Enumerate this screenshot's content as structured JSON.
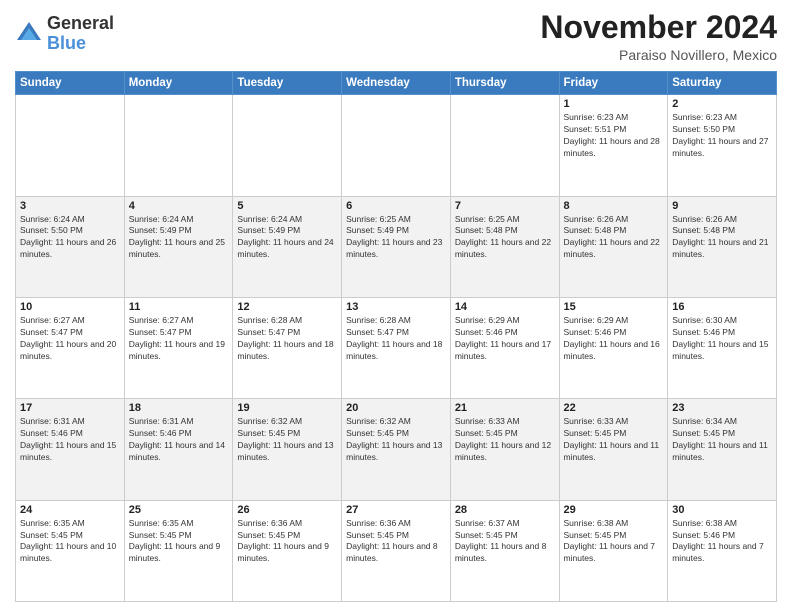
{
  "logo": {
    "general": "General",
    "blue": "Blue"
  },
  "title": "November 2024",
  "location": "Paraiso Novillero, Mexico",
  "days_of_week": [
    "Sunday",
    "Monday",
    "Tuesday",
    "Wednesday",
    "Thursday",
    "Friday",
    "Saturday"
  ],
  "weeks": [
    [
      {
        "day": "",
        "info": ""
      },
      {
        "day": "",
        "info": ""
      },
      {
        "day": "",
        "info": ""
      },
      {
        "day": "",
        "info": ""
      },
      {
        "day": "",
        "info": ""
      },
      {
        "day": "1",
        "info": "Sunrise: 6:23 AM\nSunset: 5:51 PM\nDaylight: 11 hours and 28 minutes."
      },
      {
        "day": "2",
        "info": "Sunrise: 6:23 AM\nSunset: 5:50 PM\nDaylight: 11 hours and 27 minutes."
      }
    ],
    [
      {
        "day": "3",
        "info": "Sunrise: 6:24 AM\nSunset: 5:50 PM\nDaylight: 11 hours and 26 minutes."
      },
      {
        "day": "4",
        "info": "Sunrise: 6:24 AM\nSunset: 5:49 PM\nDaylight: 11 hours and 25 minutes."
      },
      {
        "day": "5",
        "info": "Sunrise: 6:24 AM\nSunset: 5:49 PM\nDaylight: 11 hours and 24 minutes."
      },
      {
        "day": "6",
        "info": "Sunrise: 6:25 AM\nSunset: 5:49 PM\nDaylight: 11 hours and 23 minutes."
      },
      {
        "day": "7",
        "info": "Sunrise: 6:25 AM\nSunset: 5:48 PM\nDaylight: 11 hours and 22 minutes."
      },
      {
        "day": "8",
        "info": "Sunrise: 6:26 AM\nSunset: 5:48 PM\nDaylight: 11 hours and 22 minutes."
      },
      {
        "day": "9",
        "info": "Sunrise: 6:26 AM\nSunset: 5:48 PM\nDaylight: 11 hours and 21 minutes."
      }
    ],
    [
      {
        "day": "10",
        "info": "Sunrise: 6:27 AM\nSunset: 5:47 PM\nDaylight: 11 hours and 20 minutes."
      },
      {
        "day": "11",
        "info": "Sunrise: 6:27 AM\nSunset: 5:47 PM\nDaylight: 11 hours and 19 minutes."
      },
      {
        "day": "12",
        "info": "Sunrise: 6:28 AM\nSunset: 5:47 PM\nDaylight: 11 hours and 18 minutes."
      },
      {
        "day": "13",
        "info": "Sunrise: 6:28 AM\nSunset: 5:47 PM\nDaylight: 11 hours and 18 minutes."
      },
      {
        "day": "14",
        "info": "Sunrise: 6:29 AM\nSunset: 5:46 PM\nDaylight: 11 hours and 17 minutes."
      },
      {
        "day": "15",
        "info": "Sunrise: 6:29 AM\nSunset: 5:46 PM\nDaylight: 11 hours and 16 minutes."
      },
      {
        "day": "16",
        "info": "Sunrise: 6:30 AM\nSunset: 5:46 PM\nDaylight: 11 hours and 15 minutes."
      }
    ],
    [
      {
        "day": "17",
        "info": "Sunrise: 6:31 AM\nSunset: 5:46 PM\nDaylight: 11 hours and 15 minutes."
      },
      {
        "day": "18",
        "info": "Sunrise: 6:31 AM\nSunset: 5:46 PM\nDaylight: 11 hours and 14 minutes."
      },
      {
        "day": "19",
        "info": "Sunrise: 6:32 AM\nSunset: 5:45 PM\nDaylight: 11 hours and 13 minutes."
      },
      {
        "day": "20",
        "info": "Sunrise: 6:32 AM\nSunset: 5:45 PM\nDaylight: 11 hours and 13 minutes."
      },
      {
        "day": "21",
        "info": "Sunrise: 6:33 AM\nSunset: 5:45 PM\nDaylight: 11 hours and 12 minutes."
      },
      {
        "day": "22",
        "info": "Sunrise: 6:33 AM\nSunset: 5:45 PM\nDaylight: 11 hours and 11 minutes."
      },
      {
        "day": "23",
        "info": "Sunrise: 6:34 AM\nSunset: 5:45 PM\nDaylight: 11 hours and 11 minutes."
      }
    ],
    [
      {
        "day": "24",
        "info": "Sunrise: 6:35 AM\nSunset: 5:45 PM\nDaylight: 11 hours and 10 minutes."
      },
      {
        "day": "25",
        "info": "Sunrise: 6:35 AM\nSunset: 5:45 PM\nDaylight: 11 hours and 9 minutes."
      },
      {
        "day": "26",
        "info": "Sunrise: 6:36 AM\nSunset: 5:45 PM\nDaylight: 11 hours and 9 minutes."
      },
      {
        "day": "27",
        "info": "Sunrise: 6:36 AM\nSunset: 5:45 PM\nDaylight: 11 hours and 8 minutes."
      },
      {
        "day": "28",
        "info": "Sunrise: 6:37 AM\nSunset: 5:45 PM\nDaylight: 11 hours and 8 minutes."
      },
      {
        "day": "29",
        "info": "Sunrise: 6:38 AM\nSunset: 5:45 PM\nDaylight: 11 hours and 7 minutes."
      },
      {
        "day": "30",
        "info": "Sunrise: 6:38 AM\nSunset: 5:46 PM\nDaylight: 11 hours and 7 minutes."
      }
    ]
  ]
}
